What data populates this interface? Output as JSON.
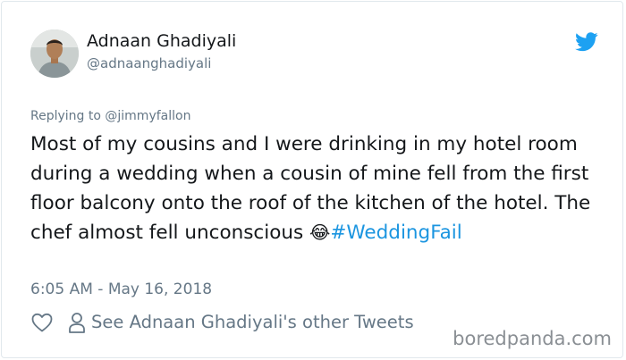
{
  "author": {
    "name": "Adnaan Ghadiyali",
    "handle": "@adnaanghadiyali"
  },
  "reply": {
    "prefix": "Replying to",
    "mention": "@jimmyfallon"
  },
  "tweet": {
    "text": "Most of my cousins and I were drinking in my hotel room during a wedding when a cousin of mine fell from the first floor balcony onto the roof of the kitchen of the hotel. The chef almost fell unconscious",
    "emoji": "😂",
    "hashtag": "#WeddingFail",
    "timestamp": "6:05 AM - May 16, 2018"
  },
  "actions": {
    "other_tweets_label": "See Adnaan Ghadiyali's other Tweets"
  },
  "icons": {
    "brand": "twitter-bird-icon",
    "like": "heart-icon",
    "profile": "person-icon"
  },
  "watermark": "boredpanda.com",
  "colors": {
    "brand_blue": "#1da1f2",
    "link_blue": "#1b95e0",
    "text": "#14171a",
    "muted": "#657786"
  }
}
